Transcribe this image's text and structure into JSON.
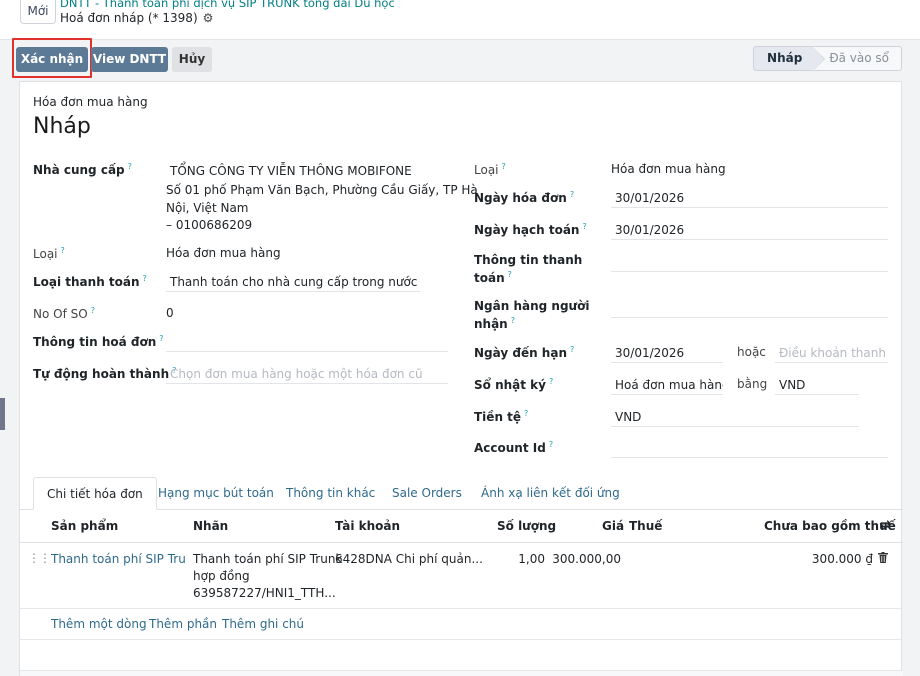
{
  "header": {
    "new_label": "Mới",
    "breadcrumb": "DNTT - Thanh toán phí dịch vụ SIP TRUNK tổng đài Du học",
    "record_title": "Hoá đơn nháp (* 1398)"
  },
  "actions": {
    "confirm": "Xác nhận",
    "view": "View DNTT",
    "cancel": "Hủy"
  },
  "status": {
    "current": "Nháp",
    "next": "Đã vào sổ"
  },
  "form": {
    "subtitle": "Hóa đơn mua hàng",
    "title": "Nháp",
    "left": {
      "vendor_label": "Nhà cung cấp",
      "vendor_name": "TỔNG CÔNG TY VIỄN THÔNG MOBIFONE",
      "vendor_addr1": "Số 01 phố Phạm Văn Bạch, Phường Cầu Giấy, TP Hà",
      "vendor_addr2": "Nội, Việt Nam",
      "vendor_tax": "– 0100686209",
      "type_label": "Loại",
      "type_value": "Hóa đơn mua hàng",
      "pay_type_label": "Loại thanh toán",
      "pay_type_value": "Thanh toán cho nhà cung cấp trong nước",
      "so_label": "No Of SO",
      "so_value": "0",
      "invoice_info_label": "Thông tin hoá đơn",
      "autocomplete_label": "Tự động hoàn thành",
      "autocomplete_placeholder": "Chọn đơn mua hàng hoặc một hóa đơn cũ"
    },
    "right": {
      "type_label": "Loại",
      "type_value": "Hóa đơn mua hàng",
      "invoice_date_label": "Ngày hóa đơn",
      "invoice_date": "30/01/2026",
      "accounting_date_label": "Ngày hạch toán",
      "accounting_date": "30/01/2026",
      "payment_info_label_1": "Thông tin thanh",
      "payment_info_label_2": "toán",
      "bank_label_1": "Ngân hàng người",
      "bank_label_2": "nhận",
      "due_date_label": "Ngày đến hạn",
      "due_date": "30/01/2026",
      "or_label": "hoặc",
      "terms_placeholder": "Điều khoản thanh",
      "journal_label": "Sổ nhật ký",
      "journal_value": "Hoá đơn mua hàng",
      "in_label": "bằng",
      "journal_currency": "VND",
      "currency_label": "Tiền tệ",
      "currency_value": "VND",
      "account_label": "Account Id"
    }
  },
  "tabs": [
    "Chi tiết hóa đơn",
    "Hạng mục bút toán",
    "Thông tin khác",
    "Sale Orders",
    "Ánh xạ liên kết đối ứng"
  ],
  "table": {
    "headers": {
      "product": "Sản phẩm",
      "label": "Nhãn",
      "account": "Tài khoản",
      "qty": "Số lượng",
      "price": "Giá",
      "tax": "Thuế",
      "subtotal": "Chưa bao gồm thuế"
    },
    "rows": [
      {
        "product": "Thanh toán phí SIP Trunk |",
        "label_1": "Thanh toán phí SIP Trunk",
        "label_2": "hợp đồng",
        "label_3": "639587227/HNI1_TTH...",
        "account": "6428DNA Chi phí quản...",
        "qty": "1,00",
        "price": "300.000,00",
        "subtotal": "300.000 ₫"
      }
    ],
    "add_line": "Thêm một dòng",
    "add_section": "Thêm phần",
    "add_note": "Thêm ghi chú"
  },
  "colors": {
    "primary": "#5c7a96",
    "link": "#2f6a8d",
    "highlight": "#e0302b"
  }
}
